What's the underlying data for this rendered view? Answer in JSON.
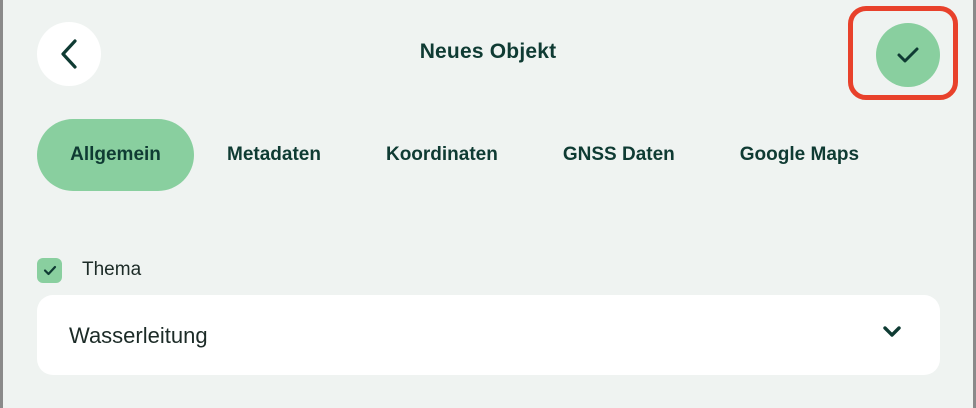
{
  "header": {
    "title": "Neues Objekt",
    "back_icon": "chevron-left-icon",
    "confirm_icon": "checkmark-icon"
  },
  "tabs": [
    {
      "label": "Allgemein",
      "active": true
    },
    {
      "label": "Metadaten",
      "active": false
    },
    {
      "label": "Koordinaten",
      "active": false
    },
    {
      "label": "GNSS Daten",
      "active": false
    },
    {
      "label": "Google Maps",
      "active": false
    }
  ],
  "form": {
    "thema": {
      "label": "Thema",
      "checked": true,
      "value": "Wasserleitung",
      "dropdown_icon": "chevron-down-icon"
    }
  },
  "colors": {
    "accent": "#89cf9f",
    "text_dark": "#0f3b33",
    "background": "#eff3f1",
    "highlight": "#e8412b"
  }
}
